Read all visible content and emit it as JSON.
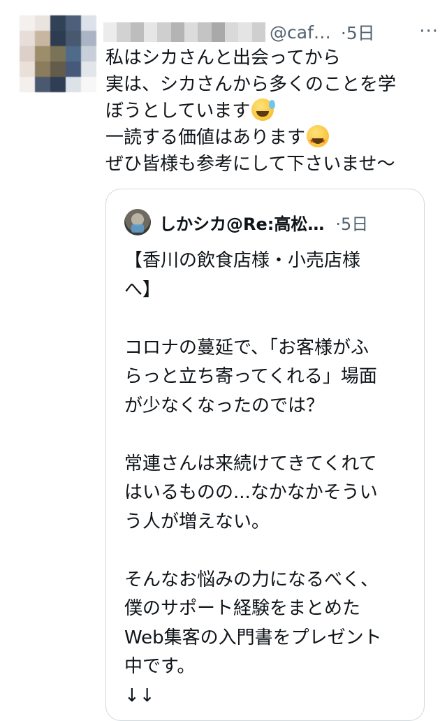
{
  "tweet": {
    "handle": "@caf…",
    "time": "·5日",
    "more": "···",
    "lines": [
      "私はシカさんと出会ってから",
      "実は、シカさんから多くのことを学",
      "ぼうとしています",
      "一読する価値はあります",
      "ぜひ皆様も参考にして下さいませ〜"
    ],
    "emoji_1": "grinning-face-with-sweat-emoji",
    "emoji_2": "star-struck-emoji"
  },
  "quote": {
    "name": "しかシカ@Re:高松…",
    "time": "·5日",
    "lines": [
      "【香川の飲食店様・小売店様",
      "へ】",
      "",
      "コロナの蔓延で、「お客様がふ",
      "らっと立ち寄ってくれる」場面",
      "が少なくなったのでは？",
      "",
      "常連さんは来続けてきてくれて",
      "はいるものの...なかなかそうい",
      "う人が増えない。",
      "",
      "そんなお悩みの力になるべく、",
      "僕のサポート経験をまとめた",
      "Web集客の入門書をプレゼント",
      "中です。",
      "↓↓"
    ]
  },
  "colors": {
    "text": "#0f1419",
    "secondary": "#536471",
    "border": "#cfd9de"
  }
}
